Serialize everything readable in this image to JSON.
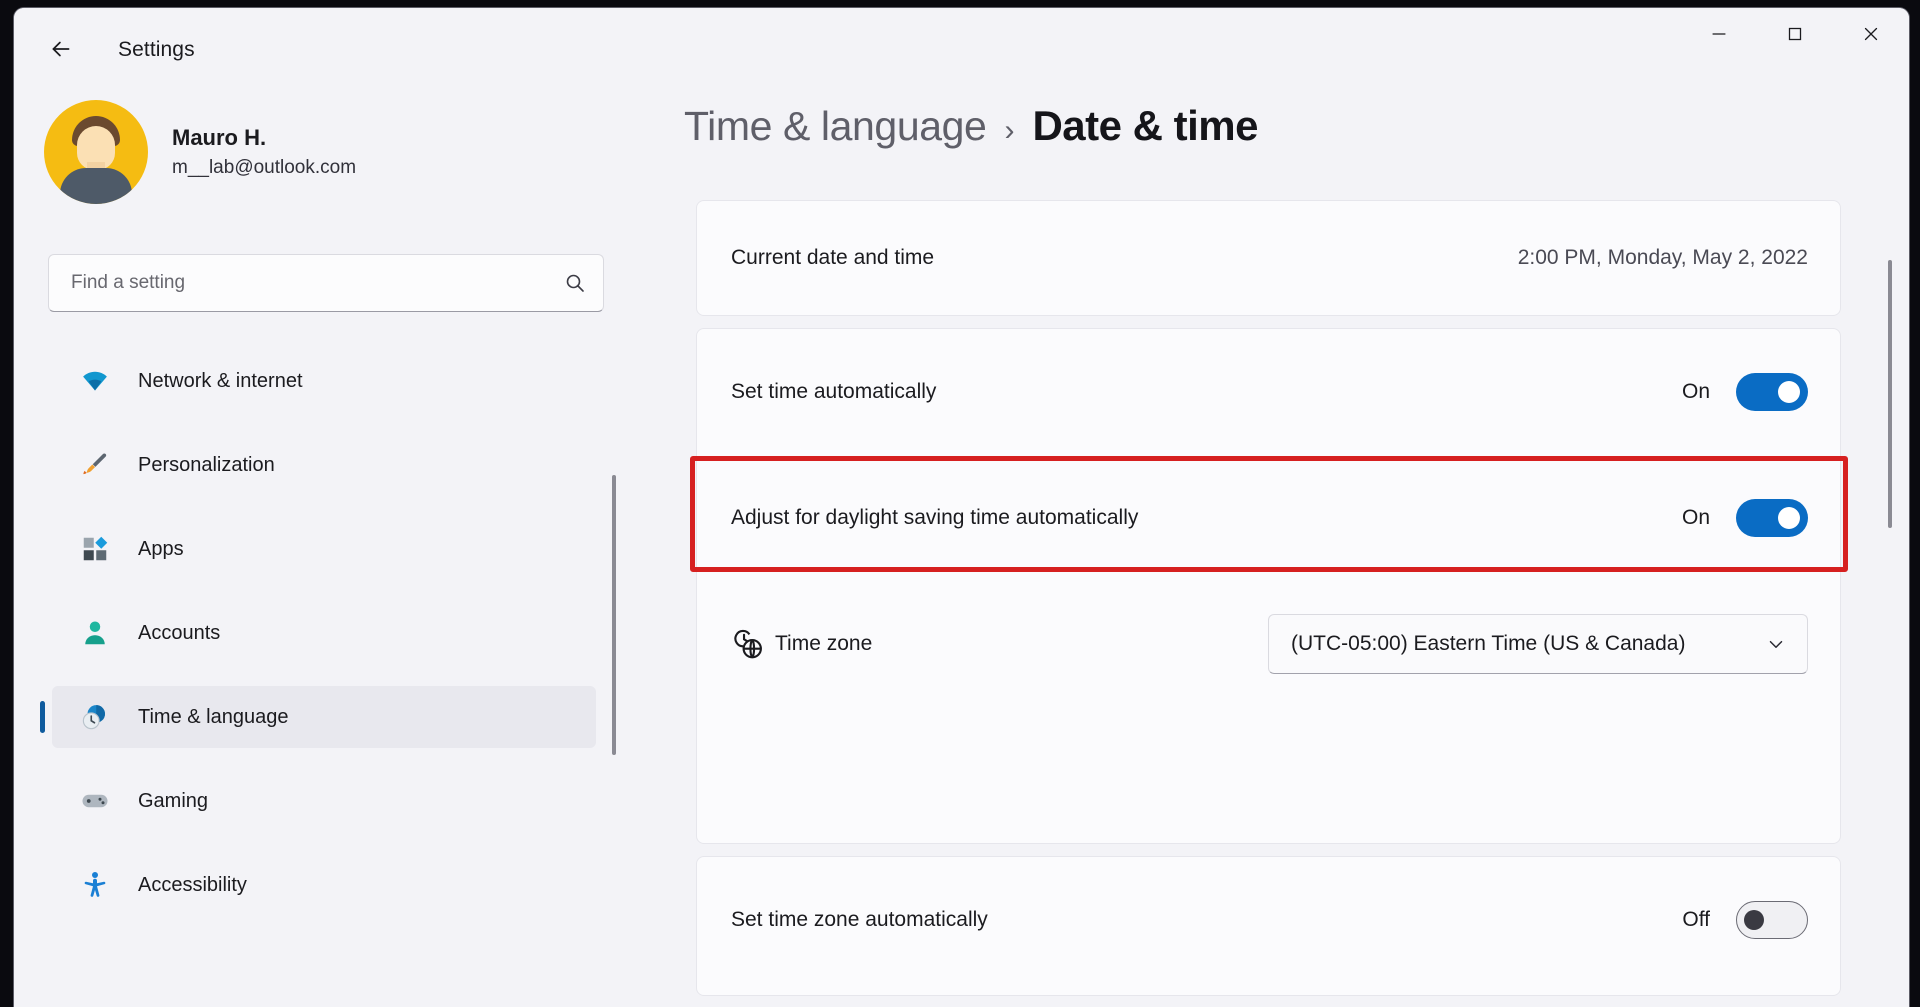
{
  "window": {
    "app_title": "Settings",
    "back_icon": "back-arrow-icon",
    "minimize_label": "—",
    "maximize_label": "□",
    "close_label": "×"
  },
  "account": {
    "name": "Mauro H.",
    "email": "m__lab@outlook.com",
    "avatar_bg": "#f5bc12"
  },
  "search": {
    "placeholder": "Find a setting",
    "value": "",
    "icon": "search-icon"
  },
  "sidebar": {
    "items": [
      {
        "label": "Network & internet",
        "icon": "wifi-icon",
        "active": false
      },
      {
        "label": "Personalization",
        "icon": "paintbrush-icon",
        "active": false
      },
      {
        "label": "Apps",
        "icon": "apps-grid-icon",
        "active": false
      },
      {
        "label": "Accounts",
        "icon": "person-icon",
        "active": false
      },
      {
        "label": "Time & language",
        "icon": "clock-globe-icon",
        "active": true
      },
      {
        "label": "Gaming",
        "icon": "gamepad-icon",
        "active": false
      },
      {
        "label": "Accessibility",
        "icon": "accessibility-icon",
        "active": false
      }
    ]
  },
  "header": {
    "breadcrumb_parent": "Time & language",
    "breadcrumb_separator": "›",
    "breadcrumb_current": "Date & time"
  },
  "settings": {
    "current_date_time": {
      "label": "Current date and time",
      "value": "2:00 PM, Monday, May 2, 2022"
    },
    "set_time_automatically": {
      "label": "Set time automatically",
      "state": "On",
      "on": true
    },
    "adjust_dst_automatically": {
      "label": "Adjust for daylight saving time automatically",
      "state": "On",
      "on": true,
      "highlighted": true
    },
    "time_zone": {
      "label": "Time zone",
      "icon": "clock-globe-icon",
      "selected": "(UTC-05:00) Eastern Time (US & Canada)",
      "chevron": "chevron-down-icon"
    },
    "set_time_zone_automatically": {
      "label": "Set time zone automatically",
      "state": "Off",
      "on": false
    }
  },
  "colors": {
    "accent": "#0a6cc4",
    "highlight_border": "#d62020",
    "window_bg": "#f3f3f7",
    "card_bg": "#fbfbfd"
  }
}
